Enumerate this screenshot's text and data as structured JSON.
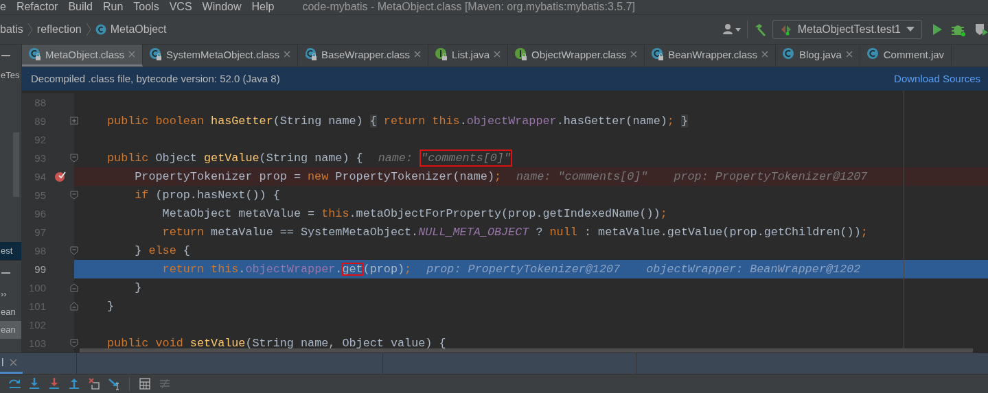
{
  "menu_bar": {
    "items": [
      "e",
      "Refactor",
      "Build",
      "Run",
      "Tools",
      "VCS",
      "Window",
      "Help"
    ],
    "title": "code-mybatis - MetaObject.class [Maven: org.mybatis:mybatis:3.5.7]"
  },
  "nav_bar": {
    "breadcrumbs": [
      {
        "text": "batis",
        "kind": "package"
      },
      {
        "text": "reflection",
        "kind": "package"
      },
      {
        "text": "MetaObject",
        "kind": "class"
      }
    ],
    "run_config": "MetaObjectTest.test1"
  },
  "side_panel": {
    "top_items": [
      {
        "text": "eTes",
        "selected": false
      },
      {
        "text": "est",
        "selected": true
      }
    ],
    "bottom_items": [
      {
        "text": "››",
        "selected": false
      },
      {
        "text": "ean",
        "selected": false
      },
      {
        "text": "ean",
        "selected": true
      }
    ]
  },
  "tabs": [
    {
      "label": "MetaObject.class",
      "kind": "class",
      "locked": true,
      "closable": true,
      "selected": true
    },
    {
      "label": "SystemMetaObject.class",
      "kind": "class",
      "locked": true,
      "closable": true,
      "selected": false
    },
    {
      "label": "BaseWrapper.class",
      "kind": "abstract",
      "locked": true,
      "closable": true,
      "selected": false
    },
    {
      "label": "List.java",
      "kind": "interface",
      "locked": true,
      "closable": true,
      "selected": false
    },
    {
      "label": "ObjectWrapper.class",
      "kind": "interface",
      "locked": true,
      "closable": true,
      "selected": false
    },
    {
      "label": "BeanWrapper.class",
      "kind": "class",
      "locked": true,
      "closable": true,
      "selected": false
    },
    {
      "label": "Blog.java",
      "kind": "class",
      "locked": false,
      "closable": true,
      "selected": false
    },
    {
      "label": "Comment.jav",
      "kind": "class",
      "locked": false,
      "closable": false,
      "selected": false
    }
  ],
  "banner": {
    "text": "Decompiled .class file, bytecode version: 52.0 (Java 8)",
    "link": "Download Sources"
  },
  "editor": {
    "lines": [
      {
        "number": "88",
        "kind": "plain",
        "breakpoint": false,
        "execution_point": false
      },
      {
        "number": "89",
        "kind": "folded",
        "breakpoint": false,
        "execution_point": false,
        "code": [
          {
            "text": "public boolean ",
            "kind": "keyword"
          },
          {
            "text": "hasGetter",
            "kind": "declaration"
          },
          {
            "text": "(String name) ",
            "kind": "plain"
          },
          {
            "text": "{",
            "kind": "folded"
          },
          {
            "text": " return this",
            "kind": "keyword"
          },
          {
            "text": ".",
            "kind": "plain"
          },
          {
            "text": "objectWrapper",
            "kind": "field"
          },
          {
            "text": ".hasGetter(name)",
            "kind": "plain"
          },
          {
            "text": "; ",
            "kind": "keyword"
          },
          {
            "text": "}",
            "kind": "folded"
          }
        ]
      },
      {
        "number": "92",
        "kind": "plain",
        "breakpoint": false,
        "execution_point": false
      },
      {
        "number": "93",
        "kind": "fold-start",
        "breakpoint": false,
        "execution_point": false,
        "code": [
          {
            "text": "public ",
            "kind": "keyword"
          },
          {
            "text": "Object ",
            "kind": "plain"
          },
          {
            "text": "getValue",
            "kind": "declaration"
          },
          {
            "text": "(String name) {",
            "kind": "plain"
          }
        ],
        "hints": [
          {
            "name": "name:",
            "value": "\"comments[0]\"",
            "boxed": true
          }
        ]
      },
      {
        "number": "94",
        "kind": "plain",
        "breakpoint": true,
        "execution_point": false,
        "code": [
          {
            "text": "    PropertyTokenizer prop = ",
            "kind": "plain"
          },
          {
            "text": "new ",
            "kind": "keyword"
          },
          {
            "text": "PropertyTokenizer(name)",
            "kind": "plain"
          },
          {
            "text": ";",
            "kind": "keyword"
          }
        ],
        "hints": [
          {
            "name": "name:",
            "value": "\"comments[0]\"",
            "boxed": false
          },
          {
            "name": "prop:",
            "value": "PropertyTokenizer@1207",
            "boxed": false
          }
        ]
      },
      {
        "number": "95",
        "kind": "fold-start",
        "breakpoint": false,
        "execution_point": false,
        "code": [
          {
            "text": "    if ",
            "kind": "keyword"
          },
          {
            "text": "(prop.hasNext()) {",
            "kind": "plain"
          }
        ]
      },
      {
        "number": "96",
        "kind": "plain",
        "breakpoint": false,
        "execution_point": false,
        "code": [
          {
            "text": "        MetaObject metaValue = ",
            "kind": "plain"
          },
          {
            "text": "this",
            "kind": "keyword"
          },
          {
            "text": ".metaObjectForProperty(prop.getIndexedName())",
            "kind": "plain"
          },
          {
            "text": ";",
            "kind": "keyword"
          }
        ]
      },
      {
        "number": "97",
        "kind": "plain",
        "breakpoint": false,
        "execution_point": false,
        "code": [
          {
            "text": "        return ",
            "kind": "keyword"
          },
          {
            "text": "metaValue == SystemMetaObject.",
            "kind": "plain"
          },
          {
            "text": "NULL_META_OBJECT",
            "kind": "constant"
          },
          {
            "text": " ? ",
            "kind": "plain"
          },
          {
            "text": "null",
            "kind": "keyword"
          },
          {
            "text": " : metaValue.getValue(prop.getChildren())",
            "kind": "plain"
          },
          {
            "text": ";",
            "kind": "keyword"
          }
        ]
      },
      {
        "number": "98",
        "kind": "fold-start",
        "breakpoint": false,
        "execution_point": false,
        "code": [
          {
            "text": "    } ",
            "kind": "plain"
          },
          {
            "text": "else ",
            "kind": "keyword"
          },
          {
            "text": "{",
            "kind": "plain"
          }
        ]
      },
      {
        "number": "99",
        "kind": "plain",
        "breakpoint": false,
        "execution_point": true,
        "code": [
          {
            "text": "        return this",
            "kind": "keyword"
          },
          {
            "text": ".",
            "kind": "plain"
          },
          {
            "text": "objectWrapper",
            "kind": "field"
          },
          {
            "text": ".",
            "kind": "plain"
          },
          {
            "text": "get",
            "kind": "boxed"
          },
          {
            "text": "(prop)",
            "kind": "plain"
          },
          {
            "text": ";",
            "kind": "keyword"
          }
        ],
        "hints": [
          {
            "name": "prop:",
            "value": "PropertyTokenizer@1207",
            "boxed": false
          },
          {
            "name": "objectWrapper:",
            "value": "BeanWrapper@1202",
            "boxed": false
          }
        ]
      },
      {
        "number": "100",
        "kind": "fold-end",
        "breakpoint": false,
        "execution_point": false,
        "code": [
          {
            "text": "    }",
            "kind": "plain"
          }
        ]
      },
      {
        "number": "101",
        "kind": "fold-end",
        "breakpoint": false,
        "execution_point": false,
        "code": [
          {
            "text": "}",
            "kind": "plain"
          }
        ]
      },
      {
        "number": "102",
        "kind": "plain",
        "breakpoint": false,
        "execution_point": false
      },
      {
        "number": "103",
        "kind": "fold-start",
        "breakpoint": false,
        "execution_point": false,
        "code": [
          {
            "text": "public void ",
            "kind": "keyword"
          },
          {
            "text": "setValue",
            "kind": "declaration"
          },
          {
            "text": "(String name, Object value) {",
            "kind": "plain"
          }
        ]
      }
    ]
  },
  "debug_panel": {
    "tab": "l",
    "tools": [
      {
        "kind": "step-over",
        "disabled": false
      },
      {
        "kind": "step-into",
        "disabled": false
      },
      {
        "kind": "force-step-into",
        "disabled": false
      },
      {
        "kind": "step-out",
        "disabled": false
      },
      {
        "kind": "drop-frame",
        "disabled": false
      },
      {
        "kind": "run-to-cursor",
        "disabled": false
      },
      {
        "kind": "evaluate",
        "disabled": false
      },
      {
        "kind": "trace",
        "disabled": true
      }
    ]
  }
}
